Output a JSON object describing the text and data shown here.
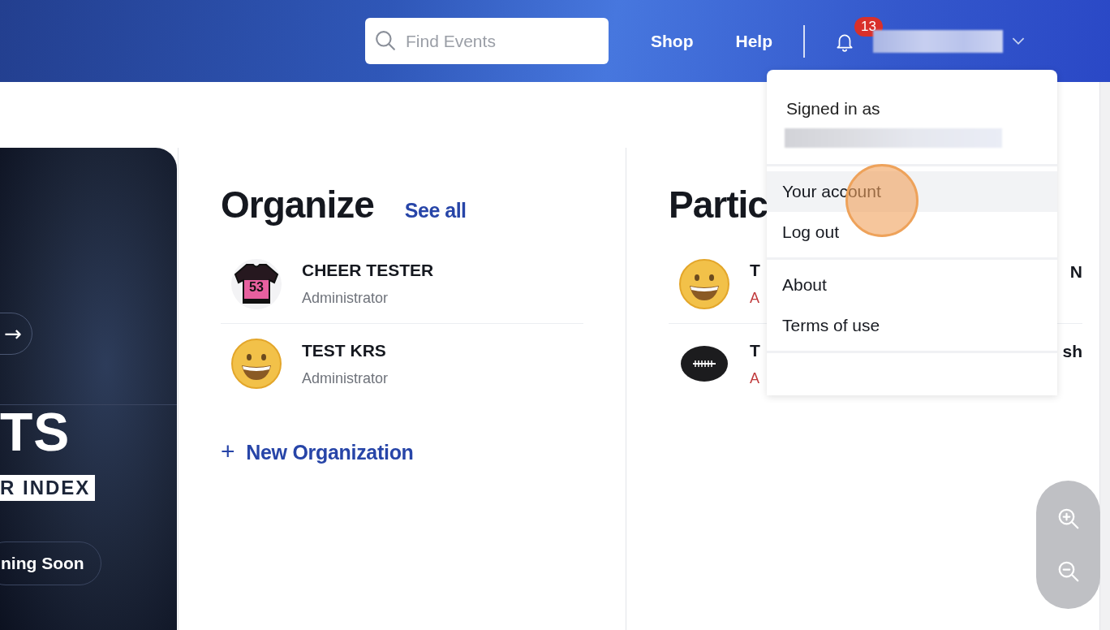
{
  "header": {
    "search": {
      "placeholder": "Find Events"
    },
    "links": [
      "Shop",
      "Help"
    ],
    "notifications": {
      "count": "13"
    }
  },
  "promo": {
    "arrow": "→",
    "title": "TS",
    "tag": "R INDEX",
    "button": "ning Soon"
  },
  "organize": {
    "title": "Organize",
    "see_all": "See all",
    "items": [
      {
        "name": "CHEER TESTER",
        "role": "Administrator",
        "kind": "jersey",
        "number": "53"
      },
      {
        "name": "TEST KRS",
        "role": "Administrator",
        "kind": "smiley"
      }
    ],
    "new_button": {
      "icon": "+",
      "label": "New Organization"
    }
  },
  "participate": {
    "title": "Partic",
    "items": [
      {
        "name_start": "T",
        "name_end": "N",
        "role": "A",
        "kind": "smiley"
      },
      {
        "name_start": "T",
        "name_end": "sh",
        "role": "A",
        "kind": "football"
      }
    ]
  },
  "account_menu": {
    "heading": "Signed in as",
    "groups": [
      [
        {
          "label": "Your account",
          "highlighted": true
        },
        {
          "label": "Log out",
          "highlighted": false
        }
      ],
      [
        {
          "label": "About",
          "highlighted": false
        },
        {
          "label": "Terms of use",
          "highlighted": false
        }
      ]
    ]
  }
}
